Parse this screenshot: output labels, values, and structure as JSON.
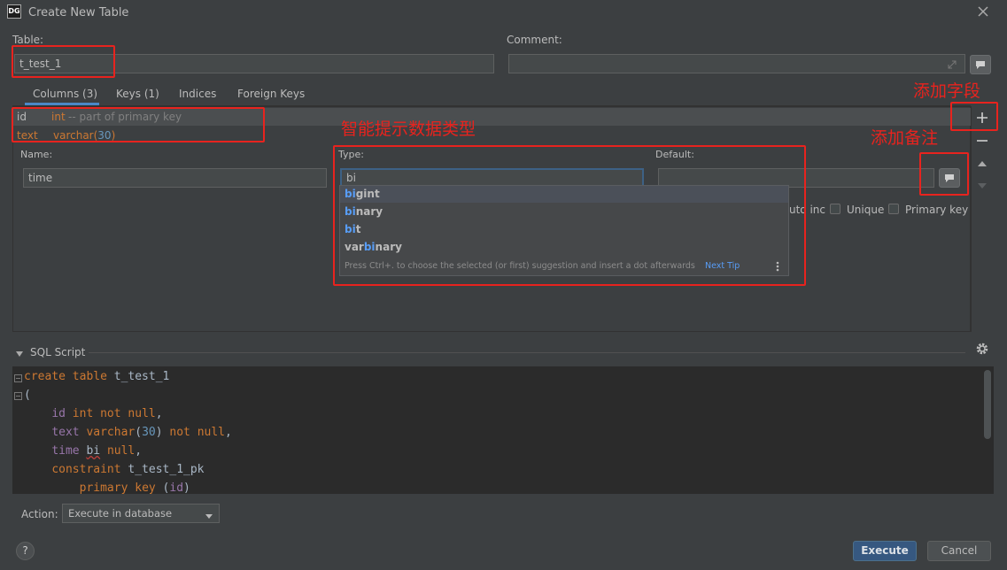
{
  "window": {
    "logo": "DG",
    "title": "Create New Table"
  },
  "table": {
    "label": "Table:",
    "value": "t_test_1"
  },
  "comment": {
    "label": "Comment:",
    "value": ""
  },
  "tabs": [
    "Columns (3)",
    "Keys (1)",
    "Indices",
    "Foreign Keys"
  ],
  "columns": [
    {
      "name": "id",
      "type": "int",
      "note": "-- part of primary key"
    },
    {
      "name": "text",
      "type": "varchar(30)"
    }
  ],
  "editor": {
    "name_label": "Name:",
    "name_value": "time",
    "type_label": "Type:",
    "type_value": "bi",
    "default_label": "Default:",
    "default_value": "",
    "auto_inc_label": "uto inc",
    "unique_label": "Unique",
    "primary_label": "Primary key"
  },
  "suggestions": {
    "items": [
      {
        "match": "bi",
        "rest": "gint"
      },
      {
        "match": "bi",
        "rest": "nary"
      },
      {
        "match": "bi",
        "rest": "t"
      },
      {
        "prefix": "var",
        "match": "bi",
        "rest": "nary"
      }
    ],
    "hint": "Press Ctrl+. to choose the selected (or first) suggestion and insert a dot afterwards",
    "next_tip": "Next Tip"
  },
  "annotations": {
    "add_field": "添加字段",
    "smart_type": "智能提示数据类型",
    "add_comment": "添加备注"
  },
  "sql": {
    "label": "SQL Script",
    "lines": [
      "create table t_test_1",
      "(",
      "    id int not null,",
      "    text varchar(30) not null,",
      "    time bi null,",
      "    constraint t_test_1_pk",
      "        primary key (id)"
    ]
  },
  "footer": {
    "action_label": "Action:",
    "action_value": "Execute in database",
    "execute": "Execute",
    "cancel": "Cancel",
    "help": "?"
  },
  "colors": {
    "accent": "#365880",
    "annotation": "#e8231e",
    "keyword": "#cc7832"
  }
}
